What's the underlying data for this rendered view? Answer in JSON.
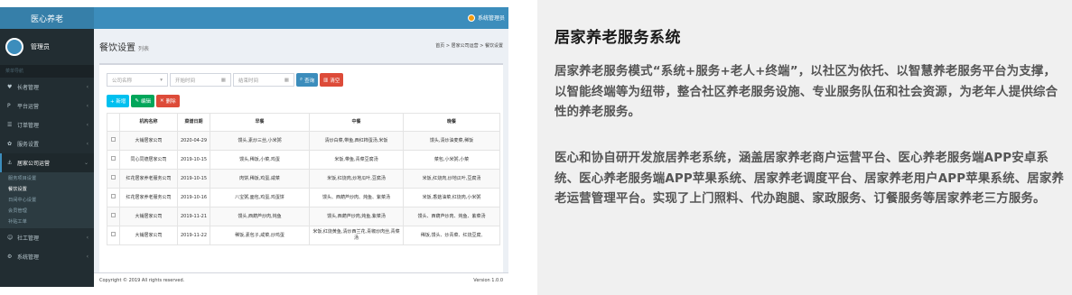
{
  "app": {
    "logo": "医心养老",
    "user_name": "管理员",
    "top_user": "系统管理员"
  },
  "sidebar": {
    "header": "菜单导航",
    "items": [
      {
        "icon": "♥",
        "label": "长者管理"
      },
      {
        "icon": "P",
        "label": "平台运营"
      },
      {
        "icon": "☰",
        "label": "订单管理"
      },
      {
        "icon": "✿",
        "label": "服务设置"
      },
      {
        "icon": "⚓",
        "label": "居家公司运营"
      }
    ],
    "sub_items": [
      "服务项目设置",
      "餐饮设置",
      "日间中心设置",
      "会员管理",
      "补贴工单"
    ],
    "items_after": [
      {
        "icon": "☺",
        "label": "社工管理"
      },
      {
        "icon": "⚙",
        "label": "系统管理"
      }
    ]
  },
  "page": {
    "title": "餐饮设置",
    "subtitle": "列表",
    "breadcrumb": "首页 > 居家公司运营 > 餐饮设置"
  },
  "filters": {
    "company": "公司名称",
    "start": "开始时间",
    "end": "结束时间",
    "query": "查询",
    "clear": "清空"
  },
  "actions": {
    "add": "+ 新增",
    "edit": "编辑",
    "delete": "删除"
  },
  "table": {
    "headers": [
      "机构名称",
      "菜谱日期",
      "早餐",
      "中餐",
      "晚餐"
    ],
    "rows": [
      [
        "大铺居家公司",
        "2020-04-29",
        "馒头,素炒三丝,小米粥",
        "清炒白菜,带鱼,西红柿蛋汤,米饭",
        "馒头,清炒油麦菜,稀饭"
      ],
      [
        "同心同德居家公司",
        "2019-10-15",
        "馒头,稀饭,小菜,鸡蛋",
        "米饭,带鱼,青菜豆腐汤",
        "菜包,小米粥,小菜"
      ],
      [
        "红花居家养老服务公司",
        "2019-10-15",
        "肉饼,稀饭,鸡蛋,咸菜",
        "米饭,红烧肉,炒地瓜叶,豆腐汤",
        "米饭,红烧肉,炒地瓜叶,豆腐汤"
      ],
      [
        "红花居家养老服务公司",
        "2019-10-16",
        "八宝粥,面包,鸡蛋,鸡蛋饼",
        "馒头、西葫芦炒肉、炖鱼、紫菜汤",
        "米饭,香菇油菜,红烧肉,小米粥"
      ],
      [
        "大铺居家公司",
        "2019-11-21",
        "馒头,西葫芦炒肉,炖鱼",
        "馒头,西葫芦炒肉,炖鱼,紫菜汤",
        "馒头、西葫芦炒肉、炖鱼、紫菜汤"
      ],
      [
        "大铺居家公司",
        "2019-11-22",
        "稀饭,素包子,咸菜,炒鸡蛋",
        "米饭,红烧黄鱼,清炒西兰花,青椒炒肉丝,青菜汤",
        "稀饭,馒头、炒青菜、红烧豆腐,"
      ]
    ]
  },
  "footer": {
    "copyright": "Copyright © 2019 All rights reserved.",
    "version": "Version 1.0.0"
  },
  "description": {
    "title": "居家养老服务系统",
    "para1": "居家养老服务模式“系统+服务+老人+终端”，以社区为依托、以智慧养老服务平台为支撑，以智能终端等为纽带，整合社区养老服务设施、专业服务队伍和社会资源，为老年人提供综合性的养老服务。",
    "para2": "医心和协自研开发旅居养老系统，涵盖居家养老商户运营平台、医心养老服务端APP安卓系统、医心养老服务端APP苹果系统、居家养老调度平台、居家养老用户APP苹果系统、居家养老运营管理平台。实现了上门照料、代办跑腿、家政服务、订餐服务等居家养老三方服务。"
  }
}
